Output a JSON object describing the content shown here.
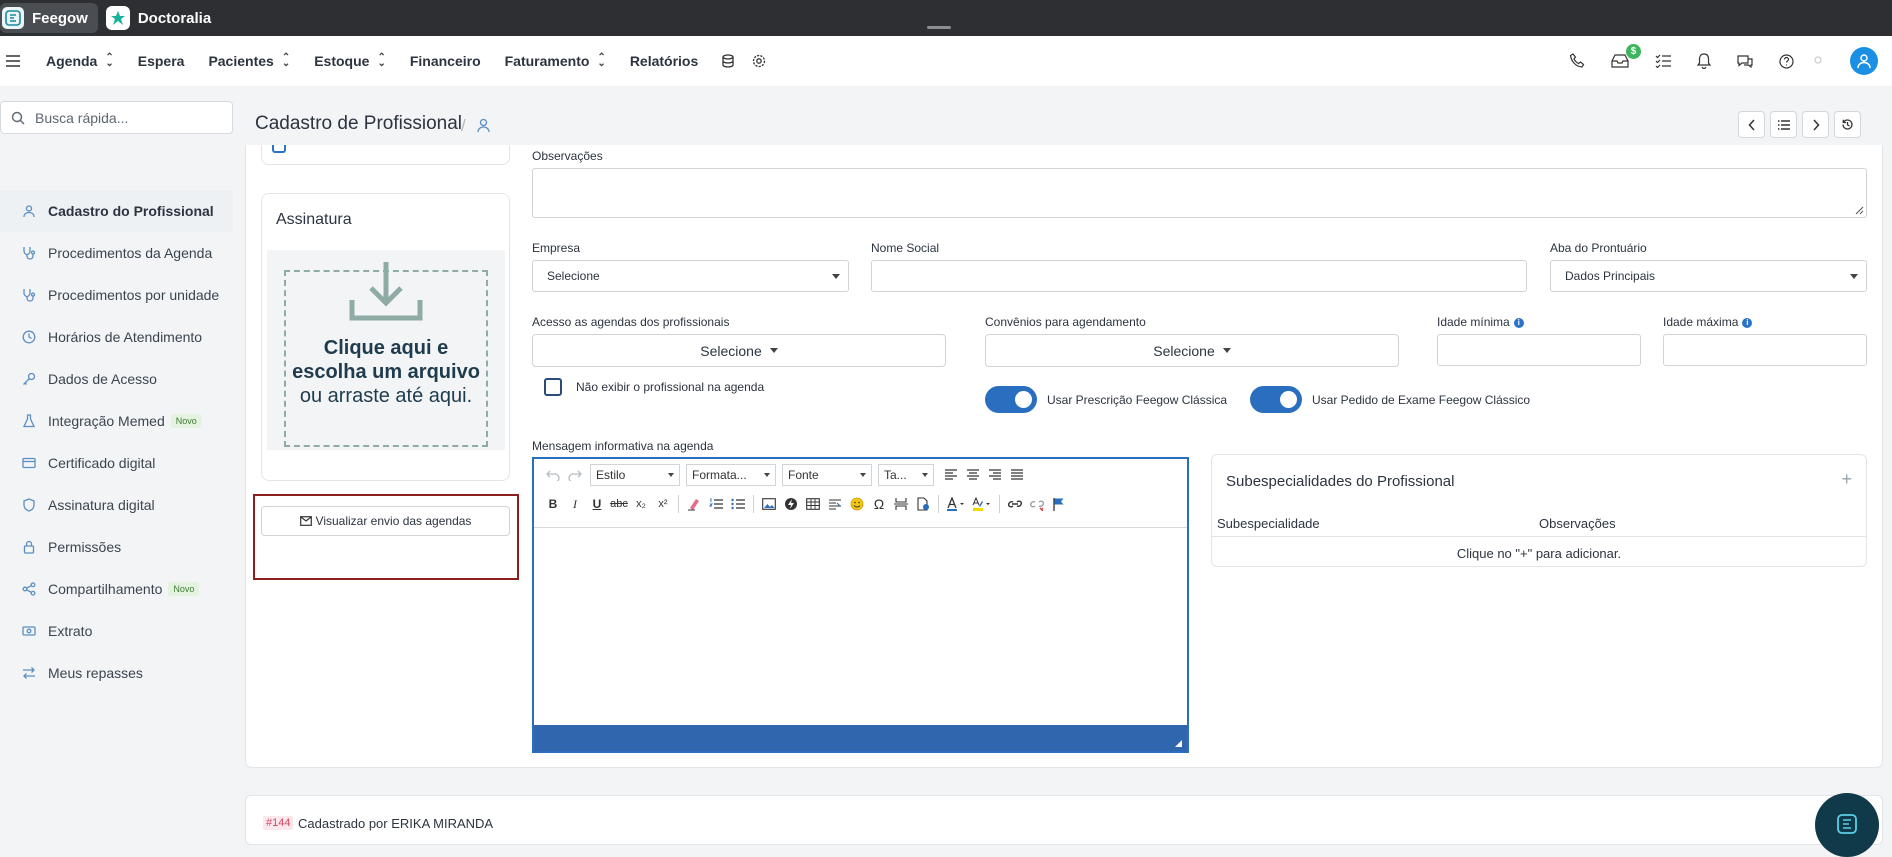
{
  "tabs": [
    {
      "label": "Feegow",
      "icon": "feegow-logo-icon"
    },
    {
      "label": "Doctoralia",
      "icon": "doctoralia-logo-icon"
    }
  ],
  "nav": {
    "items": [
      "Agenda",
      "Espera",
      "Pacientes",
      "Estoque",
      "Financeiro",
      "Faturamento",
      "Relatórios"
    ],
    "notification_badge": "$"
  },
  "search": {
    "placeholder": "Busca rápida..."
  },
  "sidebar": {
    "items": [
      {
        "label": "Cadastro do Profissional",
        "icon": "user-icon"
      },
      {
        "label": "Procedimentos da Agenda",
        "icon": "stethoscope-icon"
      },
      {
        "label": "Procedimentos por unidade",
        "icon": "stethoscope-icon"
      },
      {
        "label": "Horários de Atendimento",
        "icon": "clock-icon"
      },
      {
        "label": "Dados de Acesso",
        "icon": "key-icon"
      },
      {
        "label": "Integração Memed",
        "icon": "flask-icon",
        "badge": "Novo"
      },
      {
        "label": "Certificado digital",
        "icon": "card-icon"
      },
      {
        "label": "Assinatura digital",
        "icon": "shield-icon"
      },
      {
        "label": "Permissões",
        "icon": "lock-icon"
      },
      {
        "label": "Compartilhamento",
        "icon": "share-icon",
        "badge": "Novo"
      },
      {
        "label": "Extrato",
        "icon": "money-icon"
      },
      {
        "label": "Meus repasses",
        "icon": "transfer-icon"
      }
    ]
  },
  "page": {
    "title": "Cadastro de Profissional",
    "separator": "/"
  },
  "signature": {
    "title": "Assinatura",
    "drop_bold": "Clique aqui e escolha um arquivo",
    "drop_rest": " ou arraste até aqui."
  },
  "view_button": "Visualizar envio das agendas",
  "form": {
    "observacoes_label": "Observações",
    "empresa_label": "Empresa",
    "empresa_value": "Selecione",
    "nome_social_label": "Nome Social",
    "aba_label": "Aba do Prontuário",
    "aba_value": "Dados Principais",
    "acesso_label": "Acesso as agendas dos profissionais",
    "acesso_value": "Selecione",
    "convenios_label": "Convênios para agendamento",
    "convenios_value": "Selecione",
    "idade_min_label": "Idade mínima",
    "idade_max_label": "Idade máxima",
    "nao_exibir_label": "Não exibir o profissional na agenda",
    "prescricao_label": "Usar Prescrição Feegow Clássica",
    "pedido_label": "Usar Pedido de Exame Feegow Clássico",
    "mensagem_label": "Mensagem informativa na agenda"
  },
  "editor": {
    "estilo": "Estilo",
    "formata": "Formata...",
    "fonte": "Fonte",
    "tamanho": "Ta..."
  },
  "subespecialidades": {
    "title": "Subespecialidades do Profissional",
    "add": "+",
    "col1": "Subespecialidade",
    "col2": "Observações",
    "empty": "Clique no \"+\" para adicionar."
  },
  "footer": {
    "id": "#144",
    "text": "Cadastrado por ERIKA MIRANDA"
  }
}
